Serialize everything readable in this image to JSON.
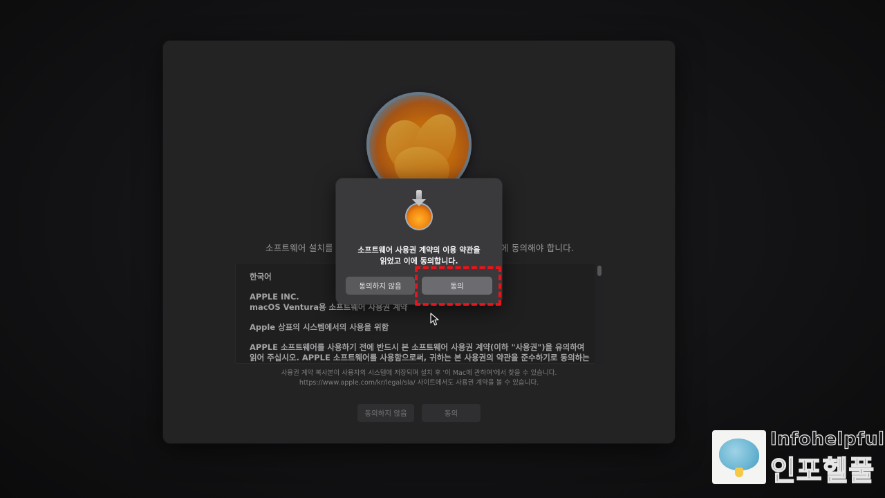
{
  "window": {
    "intro_left": "소프트웨어 설치를 ",
    "intro_right": "에 동의해야 합니다.",
    "license": {
      "language": "한국어",
      "company": "APPLE INC.",
      "product_line": "macOS Ventura용 소프트웨어 사용권 계약",
      "usage": "Apple 상표의 시스템에서의 사용을 위함",
      "body_line1": "APPLE 소프트웨어를 사용하기 전에 반드시 본 소프트웨어 사용권 계약(이하 \"사용권\")을 유의하여",
      "body_line2": "읽어 주십시오. APPLE 소프트웨어를 사용함으로써, 귀하는 본 사용권의 약관을 준수하기로 동의하는"
    },
    "footer_line1": "사용권 계약 복사본이 사용자의 시스템에 저장되며 설치 후 '이 Mac에 관하여'에서 찾을 수 있습니다.",
    "footer_line2": "https://www.apple.com/kr/legal/sla/ 사이트에서도 사용권 계약을 볼 수 있습니다.",
    "disagree_label": "동의하지 않음",
    "agree_label": "동의"
  },
  "dialog": {
    "message_line1": "소프트웨어 사용권 계약의 이용 약관을",
    "message_line2": "읽었고 이에 동의합니다.",
    "disagree_label": "동의하지 않음",
    "agree_label": "동의"
  },
  "watermark": {
    "brand_en": "Infohelpful",
    "brand_ko": "인포헬풀"
  },
  "colors": {
    "highlight": "#e8141b",
    "window_bg": "#2b2b2d",
    "dialog_bg": "#3a3a3c"
  }
}
